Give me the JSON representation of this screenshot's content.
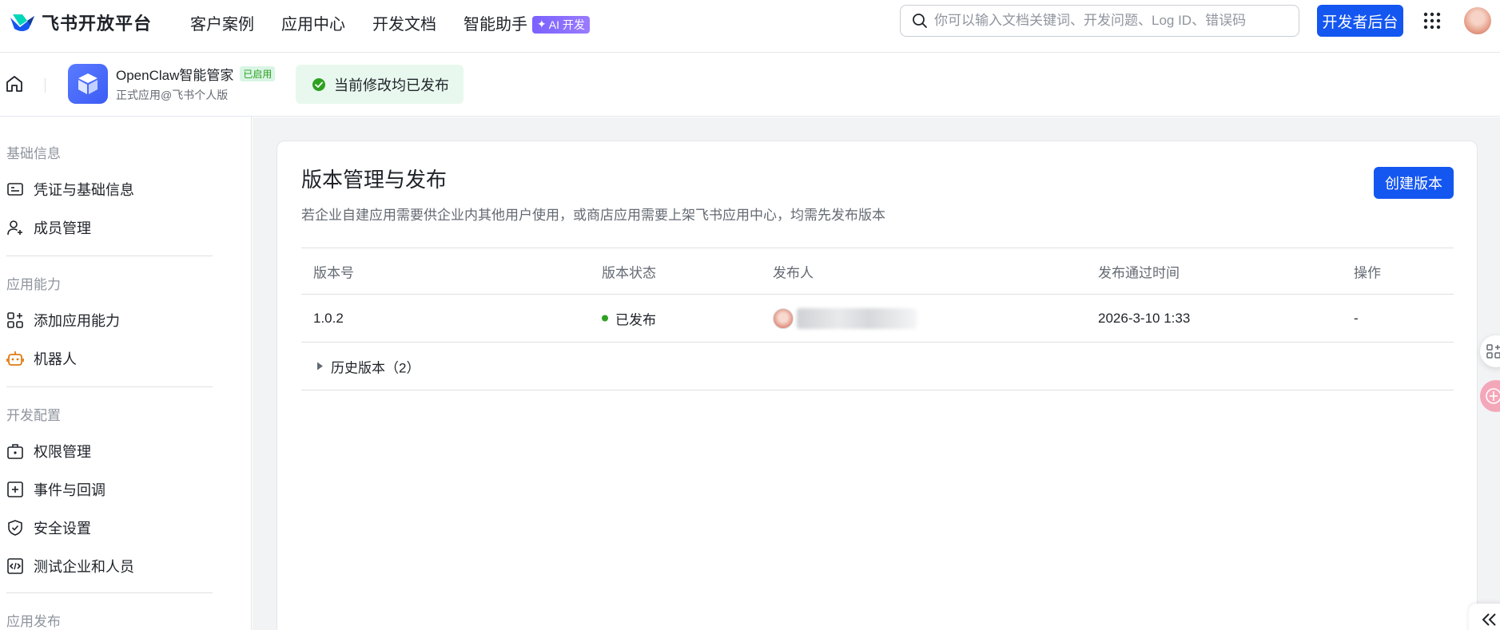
{
  "brand": {
    "name": "飞书开放平台"
  },
  "nav": {
    "links": [
      "客户案例",
      "应用中心",
      "开发文档",
      "智能助手"
    ],
    "ai_badge": "AI 开发"
  },
  "search": {
    "placeholder": "你可以输入文档关键词、开发问题、Log ID、错误码"
  },
  "dev_button": "开发者后台",
  "app": {
    "name": "OpenClaw智能管家",
    "status_tag": "已启用",
    "subtitle": "正式应用@飞书个人版",
    "publish_note": "当前修改均已发布"
  },
  "sidebar": {
    "sections": [
      {
        "title": "基础信息",
        "items": [
          "凭证与基础信息",
          "成员管理"
        ]
      },
      {
        "title": "应用能力",
        "items": [
          "添加应用能力",
          "机器人"
        ]
      },
      {
        "title": "开发配置",
        "items": [
          "权限管理",
          "事件与回调",
          "安全设置",
          "测试企业和人员"
        ]
      },
      {
        "title": "应用发布",
        "items": []
      }
    ]
  },
  "main": {
    "title": "版本管理与发布",
    "description": "若企业自建应用需要供企业内其他用户使用，或商店应用需要上架飞书应用中心，均需先发布版本",
    "create_button": "创建版本",
    "table": {
      "headers": [
        "版本号",
        "版本状态",
        "发布人",
        "发布通过时间",
        "操作"
      ],
      "rows": [
        {
          "version": "1.0.2",
          "status": "已发布",
          "time": "2026-3-10 1:33",
          "action": "-"
        }
      ],
      "history_label": "历史版本（2）"
    }
  },
  "colors": {
    "primary": "#1456f0",
    "success": "#2ea121",
    "bg": "#f2f3f5"
  }
}
